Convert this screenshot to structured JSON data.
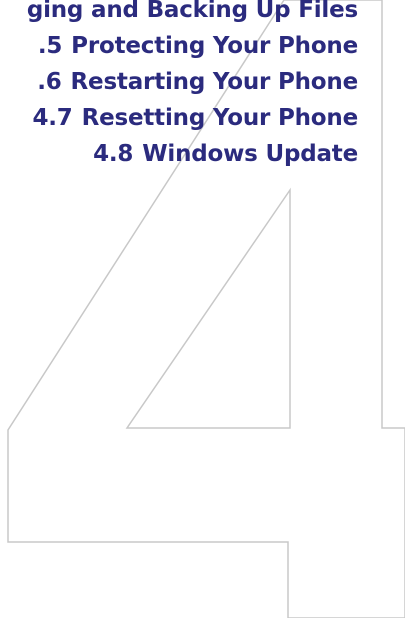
{
  "toc": {
    "entries": [
      {
        "num": "",
        "title": "ging and Backing Up Files"
      },
      {
        "num": ".5",
        "title": "Protecting Your Phone"
      },
      {
        "num": ".6",
        "title": "Restarting Your Phone"
      },
      {
        "num": "4.7",
        "title": "Resetting Your Phone"
      },
      {
        "num": "4.8",
        "title": "Windows Update"
      }
    ]
  },
  "colors": {
    "heading": "#2b2b7e",
    "outline": "#c8c8c8"
  },
  "decoration": {
    "chapter_numeral": "4"
  }
}
